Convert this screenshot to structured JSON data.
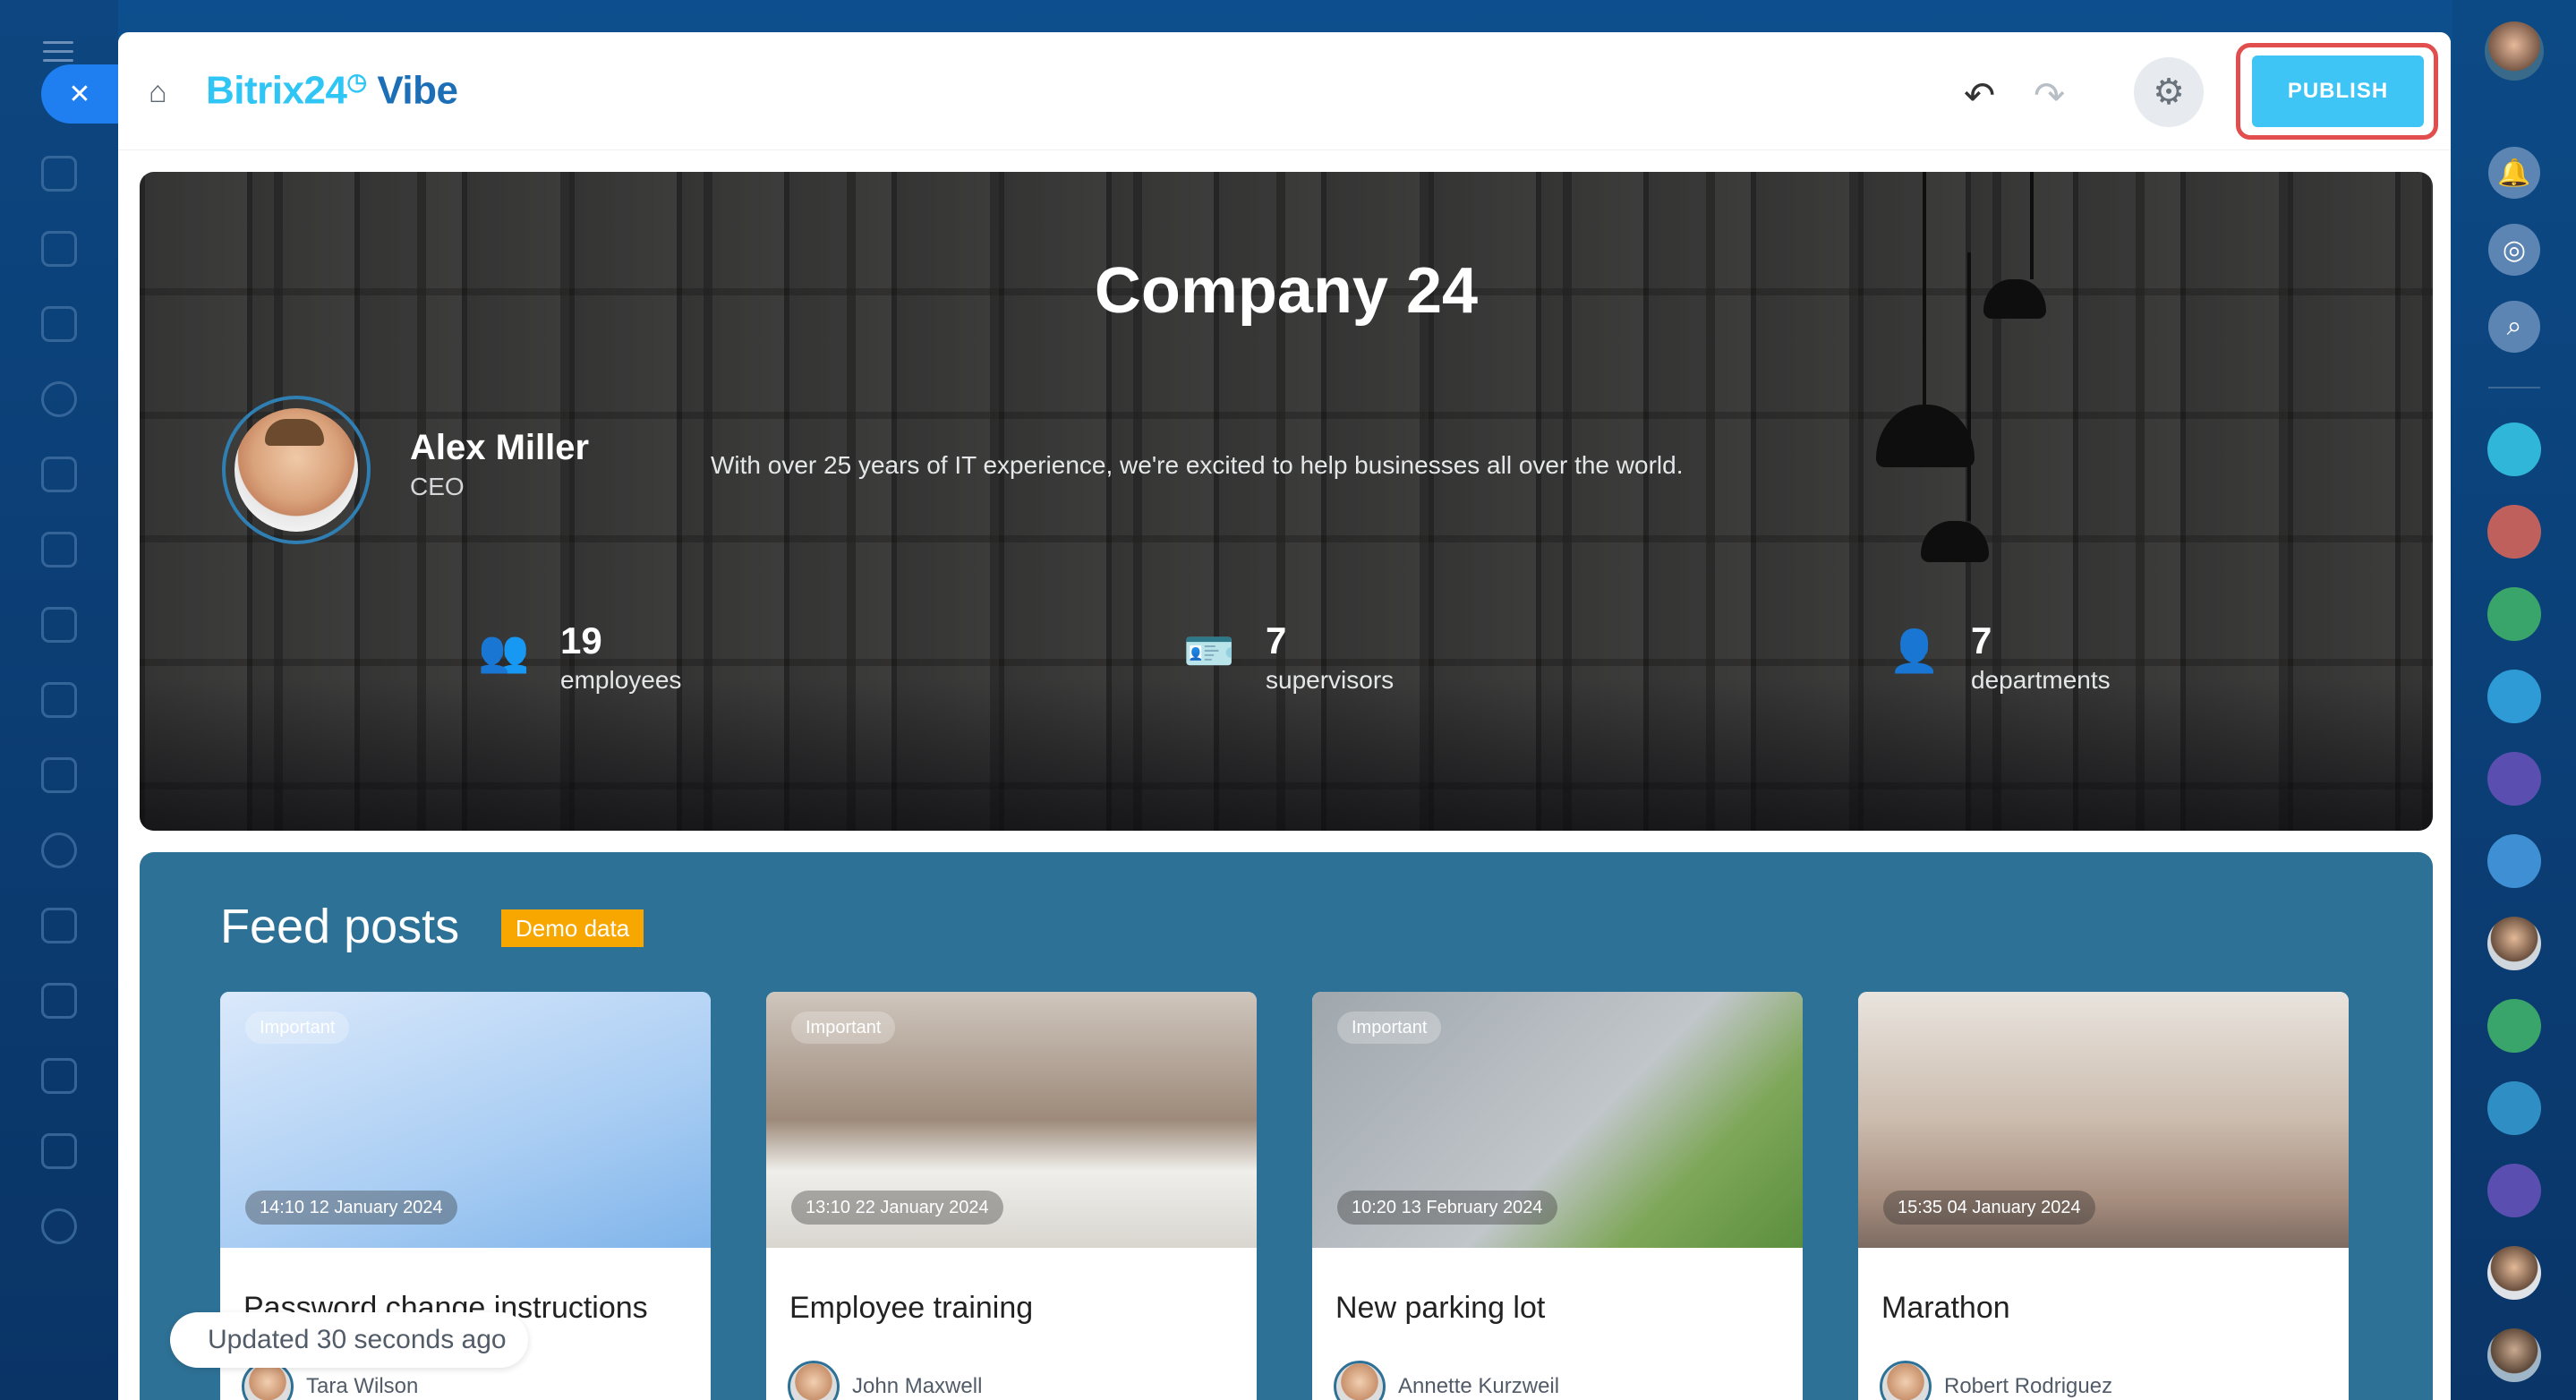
{
  "app": {
    "brand_main": "Bitrix24",
    "brand_clock": "◷",
    "brand_product": "Vibe"
  },
  "toolbar": {
    "publish_label": "PUBLISH"
  },
  "hero": {
    "title": "Company 24",
    "ceo_name": "Alex Miller",
    "ceo_role": "CEO",
    "description": "With over 25 years of IT experience, we're excited to help businesses all over the world.",
    "stats": [
      {
        "value": "19",
        "label": "employees",
        "icon": "people-icon"
      },
      {
        "value": "7",
        "label": "supervisors",
        "icon": "id-card-icon"
      },
      {
        "value": "7",
        "label": "departments",
        "icon": "user-tie-icon"
      }
    ]
  },
  "feed": {
    "title": "Feed posts",
    "badge": "Demo data",
    "posts": [
      {
        "important": "Important",
        "date": "14:10 12 January 2024",
        "title": "Password change instructions",
        "author": "Tara Wilson"
      },
      {
        "important": "Important",
        "date": "13:10 22 January 2024",
        "title": "Employee training",
        "author": "John Maxwell"
      },
      {
        "important": "Important",
        "date": "10:20 13 February 2024",
        "title": "New parking lot",
        "author": "Annette Kurzweil"
      },
      {
        "important": "",
        "date": "15:35 04 January 2024",
        "title": "Marathon",
        "author": "Robert Rodriguez"
      }
    ]
  },
  "status": {
    "updated": "Updated 30 seconds ago"
  },
  "colors": {
    "accent": "#2fc6f6",
    "publish": "#3fc5f5",
    "feed_bg": "#2e7196",
    "demo_badge": "#f7a700",
    "highlight": "#e24d4d"
  }
}
